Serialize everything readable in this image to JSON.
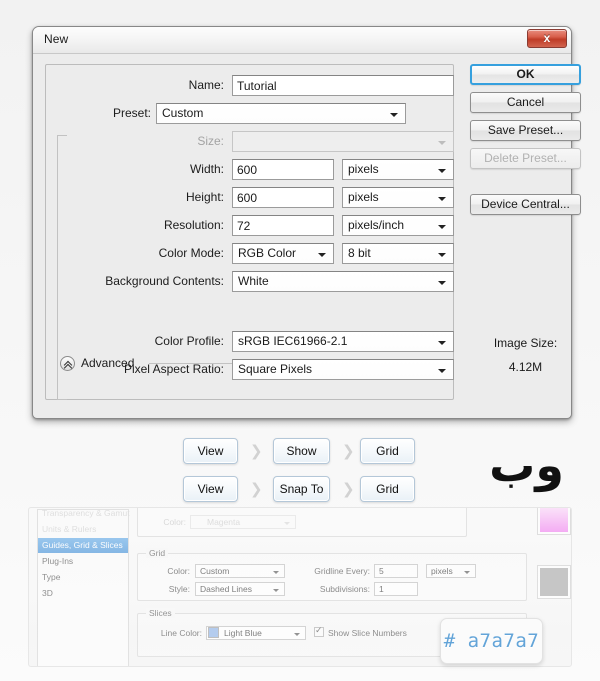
{
  "dialog": {
    "title": "New",
    "close_label": "x",
    "fields": [
      {
        "label": "Name:",
        "value": "Tutorial",
        "type": "text"
      },
      {
        "label": "Preset:",
        "value": "Custom",
        "type": "combo"
      },
      {
        "label": "Size:",
        "value": "",
        "type": "combo-disabled"
      },
      {
        "label": "Width:",
        "value": "600",
        "unit": "pixels",
        "type": "text-unit"
      },
      {
        "label": "Height:",
        "value": "600",
        "unit": "pixels",
        "type": "text-unit"
      },
      {
        "label": "Resolution:",
        "value": "72",
        "unit": "pixels/inch",
        "type": "text-unit"
      },
      {
        "label": "Color Mode:",
        "value": "RGB Color",
        "unit": "8 bit",
        "type": "combo-unit"
      },
      {
        "label": "Background Contents:",
        "value": "White",
        "type": "combo"
      },
      {
        "label": "Color Profile:",
        "value": "sRGB IEC61966-2.1",
        "type": "combo"
      },
      {
        "label": "Pixel Aspect Ratio:",
        "value": "Square Pixels",
        "type": "combo"
      }
    ],
    "advanced_label": "Advanced",
    "buttons": [
      {
        "label": "OK",
        "state": "primary"
      },
      {
        "label": "Cancel",
        "state": "normal"
      },
      {
        "label": "Save Preset...",
        "state": "normal"
      },
      {
        "label": "Delete Preset...",
        "state": "disabled"
      },
      {
        "label": "Device Central...",
        "state": "normal"
      }
    ],
    "image_size_label": "Image Size:",
    "image_size_value": "4.12M"
  },
  "breadcrumbs": {
    "row1": [
      "View",
      "Show",
      "Grid"
    ],
    "row2": [
      "View",
      "Snap To",
      "Grid"
    ],
    "separator": "chevron-right"
  },
  "logo": {
    "glyph": "وب"
  },
  "prefs": {
    "sidebar": [
      {
        "label": "Transparency & Gamut",
        "state": "faint"
      },
      {
        "label": "Units & Rulers",
        "state": "faint"
      },
      {
        "label": "Guides, Grid & Slices",
        "state": "selected"
      },
      {
        "label": "Plug-Ins",
        "state": "normal"
      },
      {
        "label": "Type",
        "state": "normal"
      },
      {
        "label": "3D",
        "state": "normal"
      }
    ],
    "top_row": {
      "label": "Color:",
      "value": "Magenta",
      "swatch": "#f0a8ec"
    },
    "grid_group": {
      "title": "Grid",
      "color_label": "Color:",
      "color_value": "Custom",
      "style_label": "Style:",
      "style_value": "Dashed Lines",
      "gridline_label": "Gridline Every:",
      "gridline_value": "5",
      "gridline_unit": "pixels",
      "subdiv_label": "Subdivisions:",
      "subdiv_value": "1",
      "swatch": "#a7a7a7"
    },
    "slices_group": {
      "title": "Slices",
      "line_color_label": "Line Color:",
      "line_color_value": "Light Blue",
      "line_color_swatch": "#8ab0e8",
      "checkbox_label": "Show Slice Numbers"
    },
    "magenta_swatch": "#f4a0f0"
  },
  "hex_callout": {
    "text": "# a7a7a7",
    "color": "#63a4d8"
  }
}
